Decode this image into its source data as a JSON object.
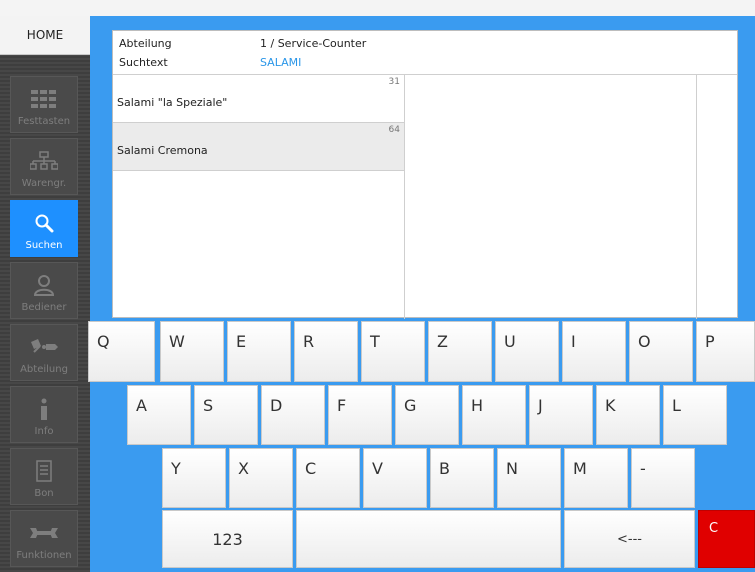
{
  "sidebar": {
    "home_label": "HOME",
    "items": [
      {
        "label": "Festtasten",
        "icon": "grid-icon",
        "active": false
      },
      {
        "label": "Warengr.",
        "icon": "hierarchy-icon",
        "active": false
      },
      {
        "label": "Suchen",
        "icon": "search-icon",
        "active": true
      },
      {
        "label": "Bediener",
        "icon": "user-icon",
        "active": false
      },
      {
        "label": "Abteilung",
        "icon": "department-icon",
        "active": false
      },
      {
        "label": "Info",
        "icon": "info-icon",
        "active": false
      },
      {
        "label": "Bon",
        "icon": "receipt-icon",
        "active": false
      },
      {
        "label": "Funktionen",
        "icon": "wrench-icon",
        "active": false
      }
    ]
  },
  "header": {
    "dept_key": "Abteilung",
    "dept_value": "1 / Service-Counter",
    "search_key": "Suchtext",
    "search_value": "SALAMI"
  },
  "results": [
    {
      "number": "31",
      "name": "Salami \"la Speziale\"",
      "selected": false
    },
    {
      "number": "64",
      "name": "Salami Cremona",
      "selected": true
    }
  ],
  "keyboard": {
    "row1": [
      "Q",
      "W",
      "E",
      "R",
      "T",
      "Z",
      "U",
      "I",
      "O",
      "P"
    ],
    "row2": [
      "A",
      "S",
      "D",
      "F",
      "G",
      "H",
      "J",
      "K",
      "L"
    ],
    "row3": [
      "Y",
      "X",
      "C",
      "V",
      "B",
      "N",
      "M",
      "-"
    ],
    "numbers_label": "123",
    "backspace_label": "<---",
    "clear_label": "C"
  },
  "colors": {
    "accent": "#3a9bf0",
    "active_sidebar": "#1e90ff",
    "clear_key": "#e00000",
    "search_text": "#2a96e8"
  }
}
